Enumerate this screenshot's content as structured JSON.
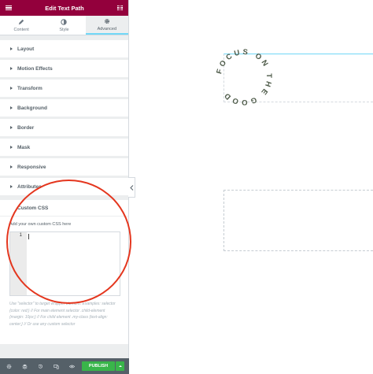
{
  "header": {
    "title": "Edit Text Path"
  },
  "tabs": [
    {
      "label": "Content",
      "icon": "pencil-icon"
    },
    {
      "label": "Style",
      "icon": "half-circle-icon"
    },
    {
      "label": "Advanced",
      "icon": "gear-icon",
      "active": true
    }
  ],
  "sections": [
    {
      "label": "Layout"
    },
    {
      "label": "Motion Effects"
    },
    {
      "label": "Transform"
    },
    {
      "label": "Background"
    },
    {
      "label": "Border"
    },
    {
      "label": "Mask"
    },
    {
      "label": "Responsive"
    },
    {
      "label": "Attributes"
    }
  ],
  "custom_css": {
    "title": "Custom CSS",
    "hint": "Add your own custom CSS here",
    "line_number": "1",
    "description": "Use \"selector\" to target wrapper element. Examples: selector {color: red;} // For main element selector .child-element {margin: 10px;} // For child element .my-class {text-align: center;} // Or use any custom selector"
  },
  "footer": {
    "publish_label": "PUBLISH"
  },
  "canvas": {
    "text_path": "FOCUS ON THE GOOD"
  },
  "colors": {
    "header_bg": "#93003c",
    "publish_green": "#39b54a",
    "annotation_red": "#e4361e",
    "text_path_color": "#4d5a48"
  }
}
